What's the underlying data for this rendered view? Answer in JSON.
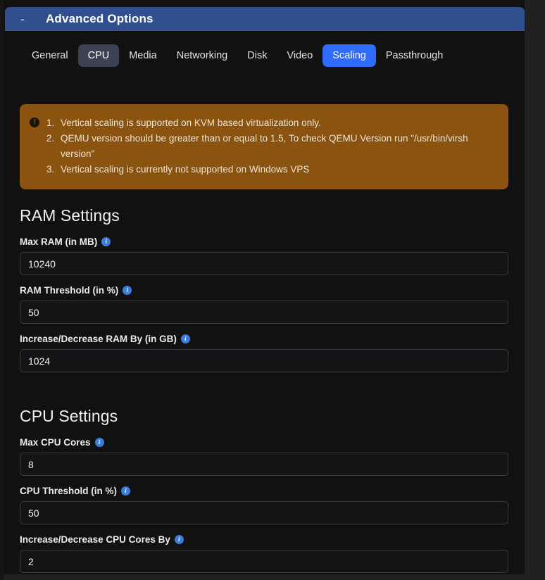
{
  "window": {
    "title": "Advanced Options",
    "collapse_glyph": "-",
    "header_color": "#314e8e"
  },
  "tabs": [
    {
      "label": "General",
      "state": "normal"
    },
    {
      "label": "CPU",
      "state": "hovered"
    },
    {
      "label": "Media",
      "state": "normal"
    },
    {
      "label": "Networking",
      "state": "normal"
    },
    {
      "label": "Disk",
      "state": "normal"
    },
    {
      "label": "Video",
      "state": "normal"
    },
    {
      "label": "Scaling",
      "state": "active"
    },
    {
      "label": "Passthrough",
      "state": "normal"
    }
  ],
  "alert": {
    "icon": "exclamation-circle-icon",
    "glyph": "!",
    "background": "#8a5410",
    "items": [
      "Vertical scaling is supported on KVM based virtualization only.",
      "QEMU version should be greater than or equal to 1.5, To check QEMU Version run \"/usr/bin/virsh version\"",
      "Vertical scaling is currently not supported on Windows VPS"
    ]
  },
  "ram_section": {
    "title": "RAM Settings",
    "fields": [
      {
        "label": "Max RAM (in MB)",
        "value": "10240",
        "placeholder": "Max RAM (in MB)"
      },
      {
        "label": "RAM Threshold (in %)",
        "value": "50",
        "placeholder": "RAM Threshold (in %)"
      },
      {
        "label": "Increase/Decrease RAM By (in GB)",
        "value": "1024",
        "placeholder": "Increase/Decrease RAM By (in GB)"
      }
    ]
  },
  "cpu_section": {
    "title": "CPU Settings",
    "fields": [
      {
        "label": "Max CPU Cores",
        "value": "8",
        "placeholder": "Max CPU Cores"
      },
      {
        "label": "CPU Threshold (in %)",
        "value": "50",
        "placeholder": "CPU Threshold (in %)"
      },
      {
        "label": "Increase/Decrease CPU Cores By",
        "value": "2",
        "placeholder": "Increase/Decrease CPU Cores By"
      }
    ]
  },
  "colors": {
    "accent_blue": "#2f6bff",
    "header_blue": "#314e8e",
    "alert_amber": "#8a5410",
    "info_blue": "#3b7ddd",
    "card_bg": "#111112",
    "page_bg": "#202022"
  }
}
